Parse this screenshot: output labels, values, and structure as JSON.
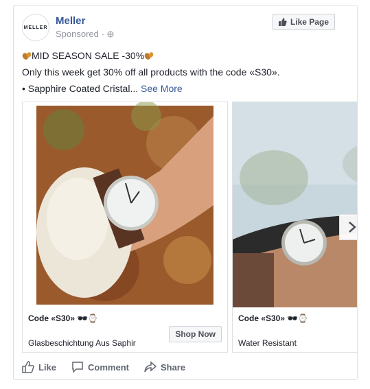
{
  "post": {
    "page_name": "Meller",
    "avatar_text": "MELLER",
    "sponsored": "Sponsored",
    "like_page_label": "Like Page",
    "line1": "MID SEASON SALE -30%",
    "line2": "Only this week get 30% off all products with the code «S30».",
    "line3": "• Sapphire Coated Cristal...",
    "see_more": "See More"
  },
  "carousel": {
    "cards": [
      {
        "headline": "Code «S30» 🕶⌚",
        "description": "Glasbeschichtung Aus Saphir",
        "cta": "Shop Now"
      },
      {
        "headline": "Code «S30» 🕶⌚",
        "description": "Water Resistant"
      }
    ]
  },
  "actions": {
    "like": "Like",
    "comment": "Comment",
    "share": "Share"
  },
  "colors": {
    "link": "#365899",
    "meta": "#90949c",
    "action": "#606770"
  },
  "icons": {
    "like_page": "thumbs-up-icon",
    "globe": "globe-icon",
    "leaf": "leaf-icon",
    "next": "chevron-right-icon",
    "like": "thumbs-up-outline-icon",
    "comment": "comment-bubble-icon",
    "share": "share-arrow-icon"
  }
}
